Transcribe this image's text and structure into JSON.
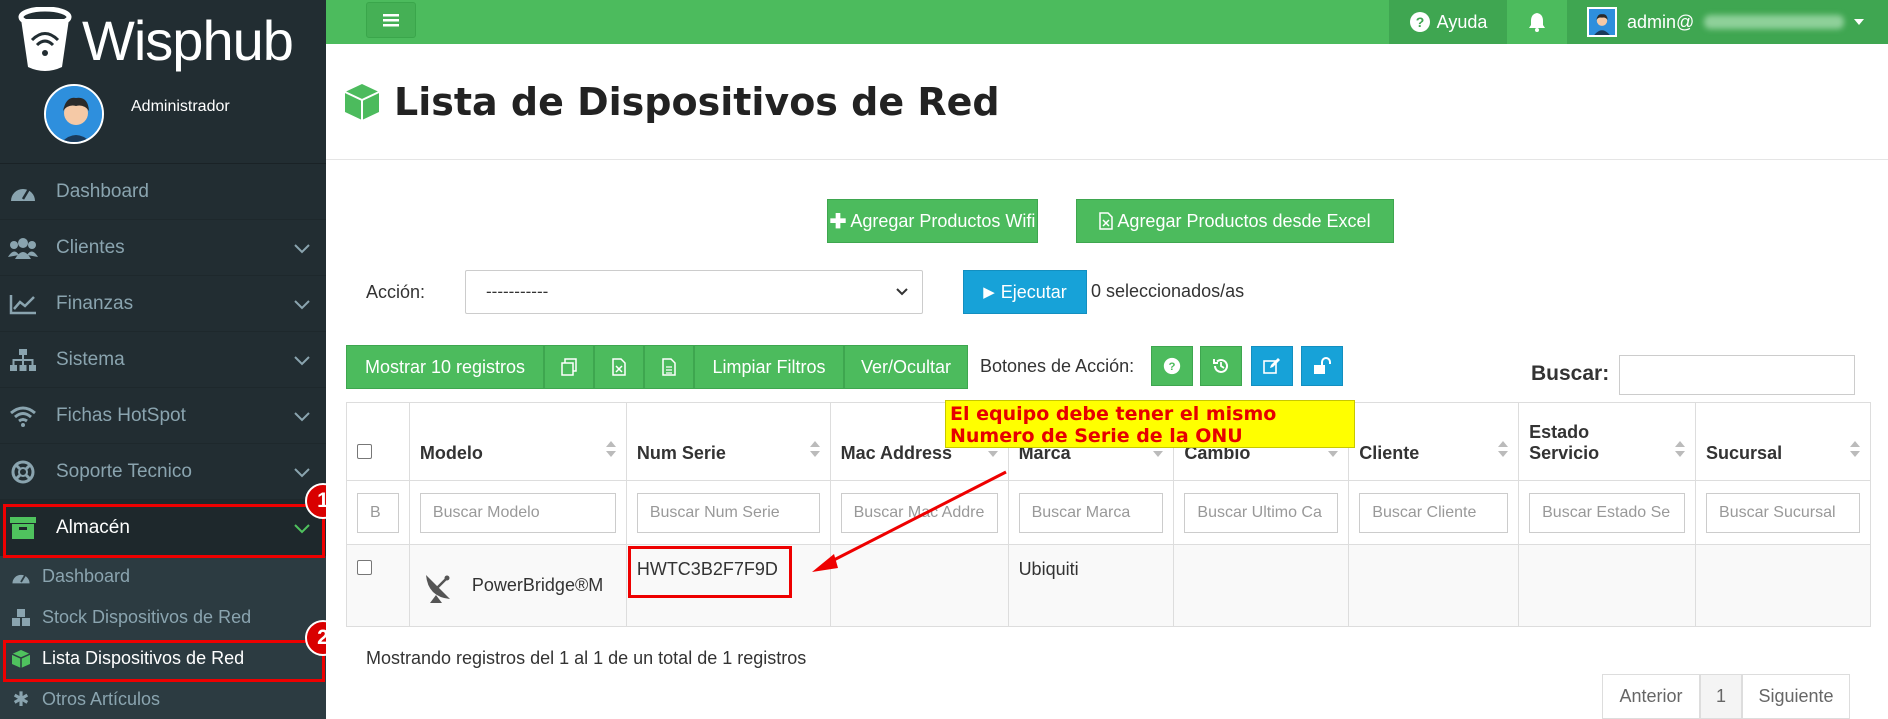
{
  "brand": {
    "name": "Wisphub"
  },
  "user": {
    "role": "Administrador"
  },
  "sidebar": {
    "items": [
      {
        "label": "Dashboard",
        "icon": "dashboard-icon",
        "chevron": false
      },
      {
        "label": "Clientes",
        "icon": "users-icon",
        "chevron": true
      },
      {
        "label": "Finanzas",
        "icon": "line-chart-icon",
        "chevron": true
      },
      {
        "label": "Sistema",
        "icon": "sitemap-icon",
        "chevron": true
      },
      {
        "label": "Fichas HotSpot",
        "icon": "wifi-icon",
        "chevron": true
      },
      {
        "label": "Soporte Tecnico",
        "icon": "life-ring-icon",
        "chevron": true
      },
      {
        "label": "Almacén",
        "icon": "archive-icon",
        "chevron": true,
        "active": true
      }
    ],
    "submenu": [
      {
        "label": "Dashboard"
      },
      {
        "label": "Stock Dispositivos de Red"
      },
      {
        "label": "Lista Dispositivos de Red",
        "active": true
      },
      {
        "label": "Otros Artículos"
      }
    ],
    "annotations": {
      "one": "1",
      "two": "2"
    }
  },
  "topbar": {
    "help": "Ayuda",
    "user": "admin@"
  },
  "page": {
    "title": "Lista de Dispositivos de Red",
    "add_wifi": "Agregar Productos Wifi",
    "add_excel": "Agregar Productos desde Excel",
    "action_label": "Acción:",
    "action_value": "-----------",
    "execute": "Ejecutar",
    "selected": "0 seleccionados/as",
    "show_records": "Mostrar 10 registros",
    "clear_filters": "Limpiar Filtros",
    "toggle_cols": "Ver/Ocultar",
    "action_buttons": "Botones de Acción:",
    "search_label": "Buscar:",
    "footer_info": "Mostrando registros del 1 al 1 de un total de 1 registros",
    "prev": "Anterior",
    "page_num": "1",
    "next": "Siguiente",
    "callout_1": "El equipo debe tener el mismo",
    "callout_2": "Numero de Serie de la ONU"
  },
  "table": {
    "headers": {
      "model": "Modelo",
      "serial": "Num Serie",
      "mac": "Mac Address",
      "brand": "Marca",
      "change": "Cambio",
      "client": "Cliente",
      "status_1": "Estado",
      "status_2": "Servicio",
      "branch": "Sucursal"
    },
    "filters": {
      "first": "B",
      "model": "Buscar Modelo",
      "serial": "Buscar Num Serie",
      "mac": "Buscar Mac Addre",
      "brand": "Buscar Marca",
      "change": "Buscar Ultimo Ca",
      "client": "Buscar Cliente",
      "status": "Buscar Estado Se",
      "branch": "Buscar Sucursal"
    },
    "row": {
      "model": "PowerBridge®M",
      "serial": "HWTC3B2F7F9D",
      "mac": "",
      "brand": "Ubiquiti",
      "change": "",
      "client": "",
      "status": "",
      "branch": ""
    }
  },
  "colors": {
    "accent": "#4cbb5d",
    "sidebar": "#222d32",
    "info": "#17a2d8",
    "highlight": "#e00000"
  }
}
